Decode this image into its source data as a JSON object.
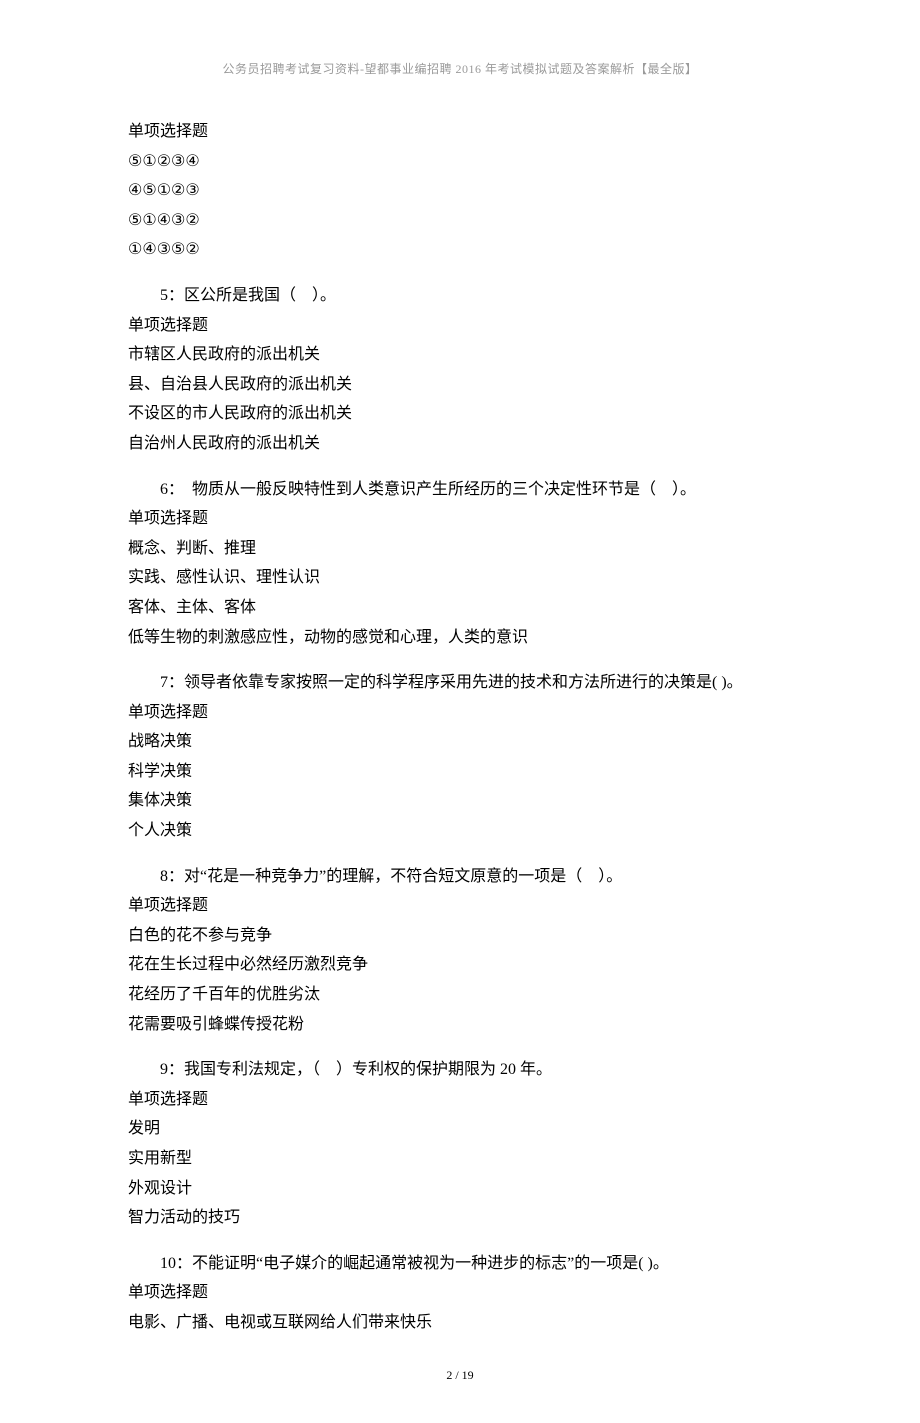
{
  "header": "公务员招聘考试复习资料-望都事业编招聘 2016 年考试模拟试题及答案解析【最全版】",
  "footer": "2 / 19",
  "blocks": [
    {
      "lines": [
        {
          "text": "单项选择题",
          "indent": false
        },
        {
          "text": "⑤①②③④",
          "indent": false
        },
        {
          "text": "④⑤①②③",
          "indent": false
        },
        {
          "text": "⑤①④③②",
          "indent": false
        },
        {
          "text": "①④③⑤②",
          "indent": false
        }
      ]
    },
    {
      "lines": [
        {
          "text": "5：区公所是我国（　）。",
          "indent": true
        },
        {
          "text": "单项选择题",
          "indent": false
        },
        {
          "text": "市辖区人民政府的派出机关",
          "indent": false
        },
        {
          "text": "县、自治县人民政府的派出机关",
          "indent": false
        },
        {
          "text": "不设区的市人民政府的派出机关",
          "indent": false
        },
        {
          "text": "自治州人民政府的派出机关",
          "indent": false
        }
      ]
    },
    {
      "lines": [
        {
          "text": "6：　物质从一般反映特性到人类意识产生所经历的三个决定性环节是（　）。",
          "indent": true
        },
        {
          "text": "单项选择题",
          "indent": false
        },
        {
          "text": "概念、判断、推理",
          "indent": false
        },
        {
          "text": "实践、感性认识、理性认识",
          "indent": false
        },
        {
          "text": "客体、主体、客体",
          "indent": false
        },
        {
          "text": "低等生物的刺激感应性，动物的感觉和心理，人类的意识",
          "indent": false
        }
      ]
    },
    {
      "lines": [
        {
          "text": "7：领导者依靠专家按照一定的科学程序采用先进的技术和方法所进行的决策是( )。",
          "indent": true
        },
        {
          "text": "单项选择题",
          "indent": false
        },
        {
          "text": "战略决策",
          "indent": false
        },
        {
          "text": "科学决策",
          "indent": false
        },
        {
          "text": "集体决策",
          "indent": false
        },
        {
          "text": "个人决策",
          "indent": false
        }
      ]
    },
    {
      "lines": [
        {
          "text": "8：对“花是一种竞争力”的理解，不符合短文原意的一项是（　）。",
          "indent": true
        },
        {
          "text": "单项选择题",
          "indent": false
        },
        {
          "text": "白色的花不参与竞争",
          "indent": false
        },
        {
          "text": "花在生长过程中必然经历激烈竞争",
          "indent": false
        },
        {
          "text": "花经历了千百年的优胜劣汰",
          "indent": false
        },
        {
          "text": "花需要吸引蜂蝶传授花粉",
          "indent": false
        }
      ]
    },
    {
      "lines": [
        {
          "text": "9：我国专利法规定，（　）专利权的保护期限为 20 年。",
          "indent": true
        },
        {
          "text": "单项选择题",
          "indent": false
        },
        {
          "text": "发明",
          "indent": false
        },
        {
          "text": "实用新型",
          "indent": false
        },
        {
          "text": "外观设计",
          "indent": false
        },
        {
          "text": "智力活动的技巧",
          "indent": false
        }
      ]
    },
    {
      "lines": [
        {
          "text": "10：不能证明“电子媒介的崛起通常被视为一种进步的标志”的一项是( )。",
          "indent": true
        },
        {
          "text": "单项选择题",
          "indent": false
        },
        {
          "text": "电影、广播、电视或互联网给人们带来快乐",
          "indent": false
        }
      ]
    }
  ]
}
